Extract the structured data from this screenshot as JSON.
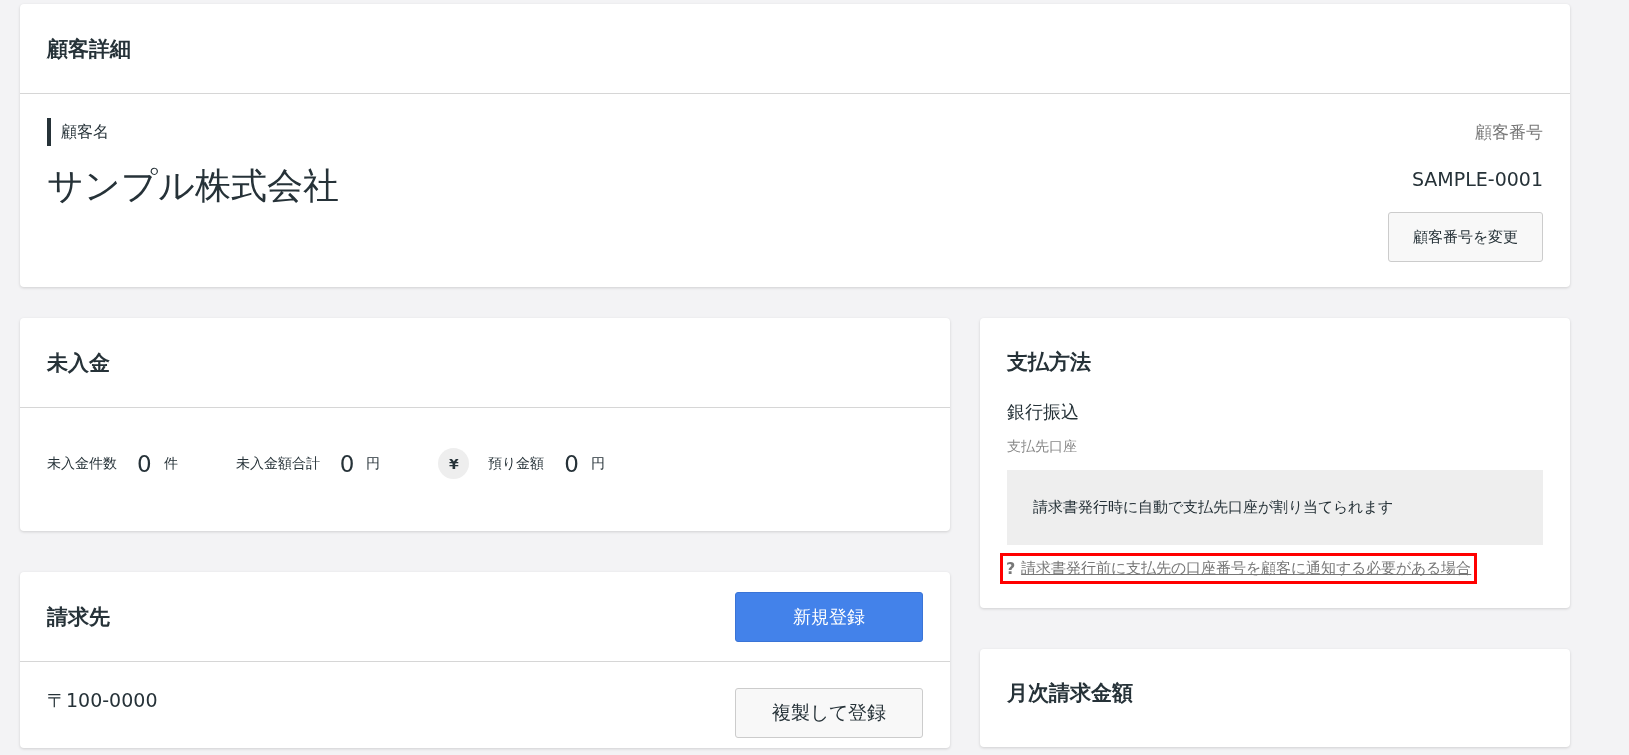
{
  "customer_card": {
    "title": "顧客詳細",
    "name_label": "顧客名",
    "name": "サンプル株式会社",
    "number_label": "顧客番号",
    "number": "SAMPLE-0001",
    "change_button": "顧客番号を変更"
  },
  "unpaid_card": {
    "title": "未入金",
    "stats": [
      {
        "label": "未入金件数",
        "value": "0",
        "unit": "件",
        "kind": "plain"
      },
      {
        "label": "未入金額合計",
        "value": "0",
        "unit": "円",
        "kind": "plain"
      },
      {
        "label": "預り金額",
        "value": "0",
        "unit": "円",
        "kind": "yen",
        "icon": "¥"
      }
    ]
  },
  "billing_card": {
    "title": "請求先",
    "new_button": "新規登録",
    "postal_code": "〒100-0000",
    "copy_button": "複製して登録"
  },
  "payment_card": {
    "title": "支払方法",
    "method": "銀行振込",
    "account_label": "支払先口座",
    "account_note": "請求書発行時に自動で支払先口座が割り当てられます",
    "help_icon": "?",
    "help_link": "請求書発行前に支払先の口座番号を顧客に通知する必要がある場合",
    "help_highlighted": true
  },
  "monthly_card": {
    "title": "月次請求金額"
  }
}
